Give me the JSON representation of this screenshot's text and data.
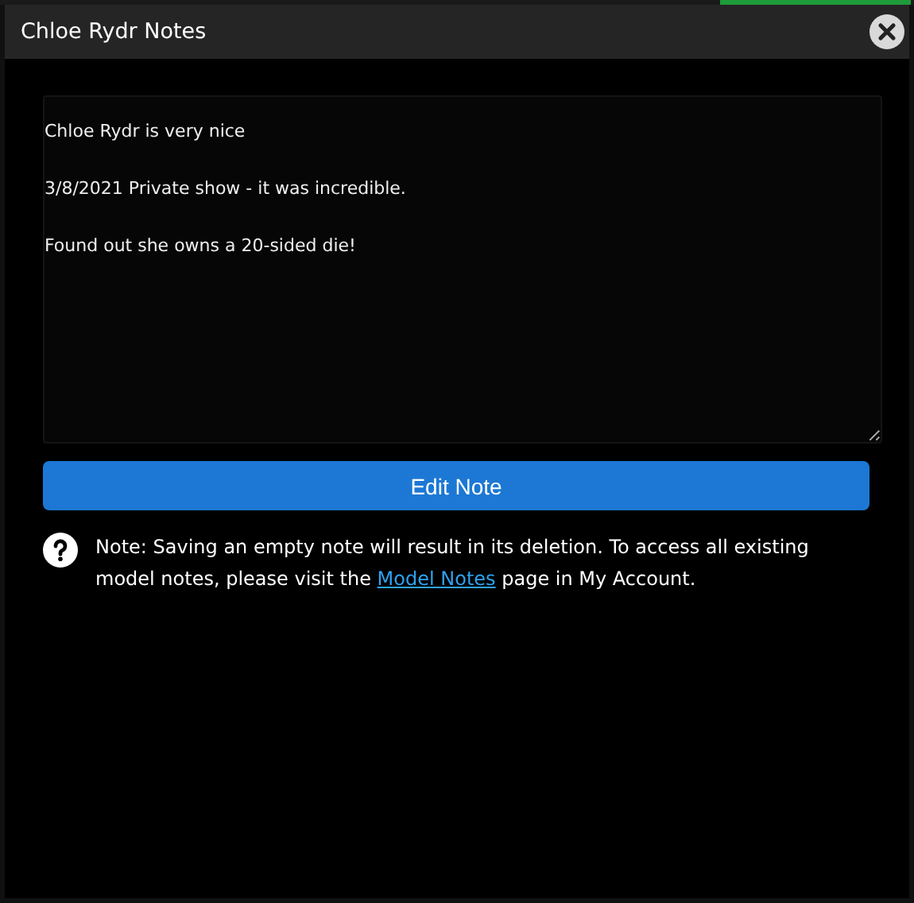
{
  "window": {
    "title": "Chloe Rydr Notes"
  },
  "note": {
    "value": "Chloe Rydr is very nice\n\n3/8/2021 Private show - it was incredible.\n\nFound out she owns a 20-sided die!"
  },
  "button": {
    "label": "Edit Note"
  },
  "info": {
    "before": "Note: Saving an empty note will result in its deletion. To access all existing model notes, please visit the ",
    "link": "Model Notes",
    "after": " page in My Account."
  }
}
